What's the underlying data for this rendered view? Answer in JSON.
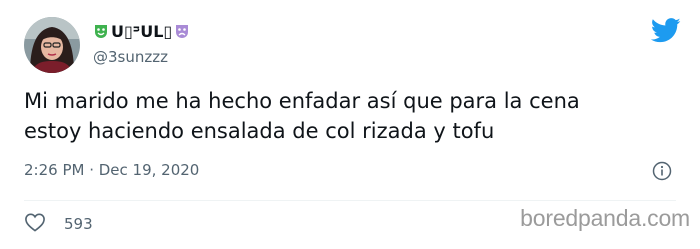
{
  "author": {
    "display_name": "U▯ᵙUL▯",
    "handle": "@3sunzzz",
    "name_emoji": [
      "performing-arts-mask-icon-green",
      "performing-arts-mask-icon-purple"
    ]
  },
  "tweet": {
    "text_lines": [
      "Mi marido me ha hecho enfadar así que para la cena",
      "estoy haciendo ensalada de col rizada y tofu"
    ],
    "timestamp": "2:26 PM · Dec 19, 2020",
    "like_count": "593"
  },
  "icons": {
    "brand": "twitter-bird-icon",
    "info": "info-icon",
    "like": "heart-icon"
  },
  "watermark": "boredpanda.com",
  "colors": {
    "twitter_blue": "#1d9bf0",
    "muted_text": "#536471",
    "divider": "#eff3f4",
    "watermark": "#9b9b9b"
  }
}
